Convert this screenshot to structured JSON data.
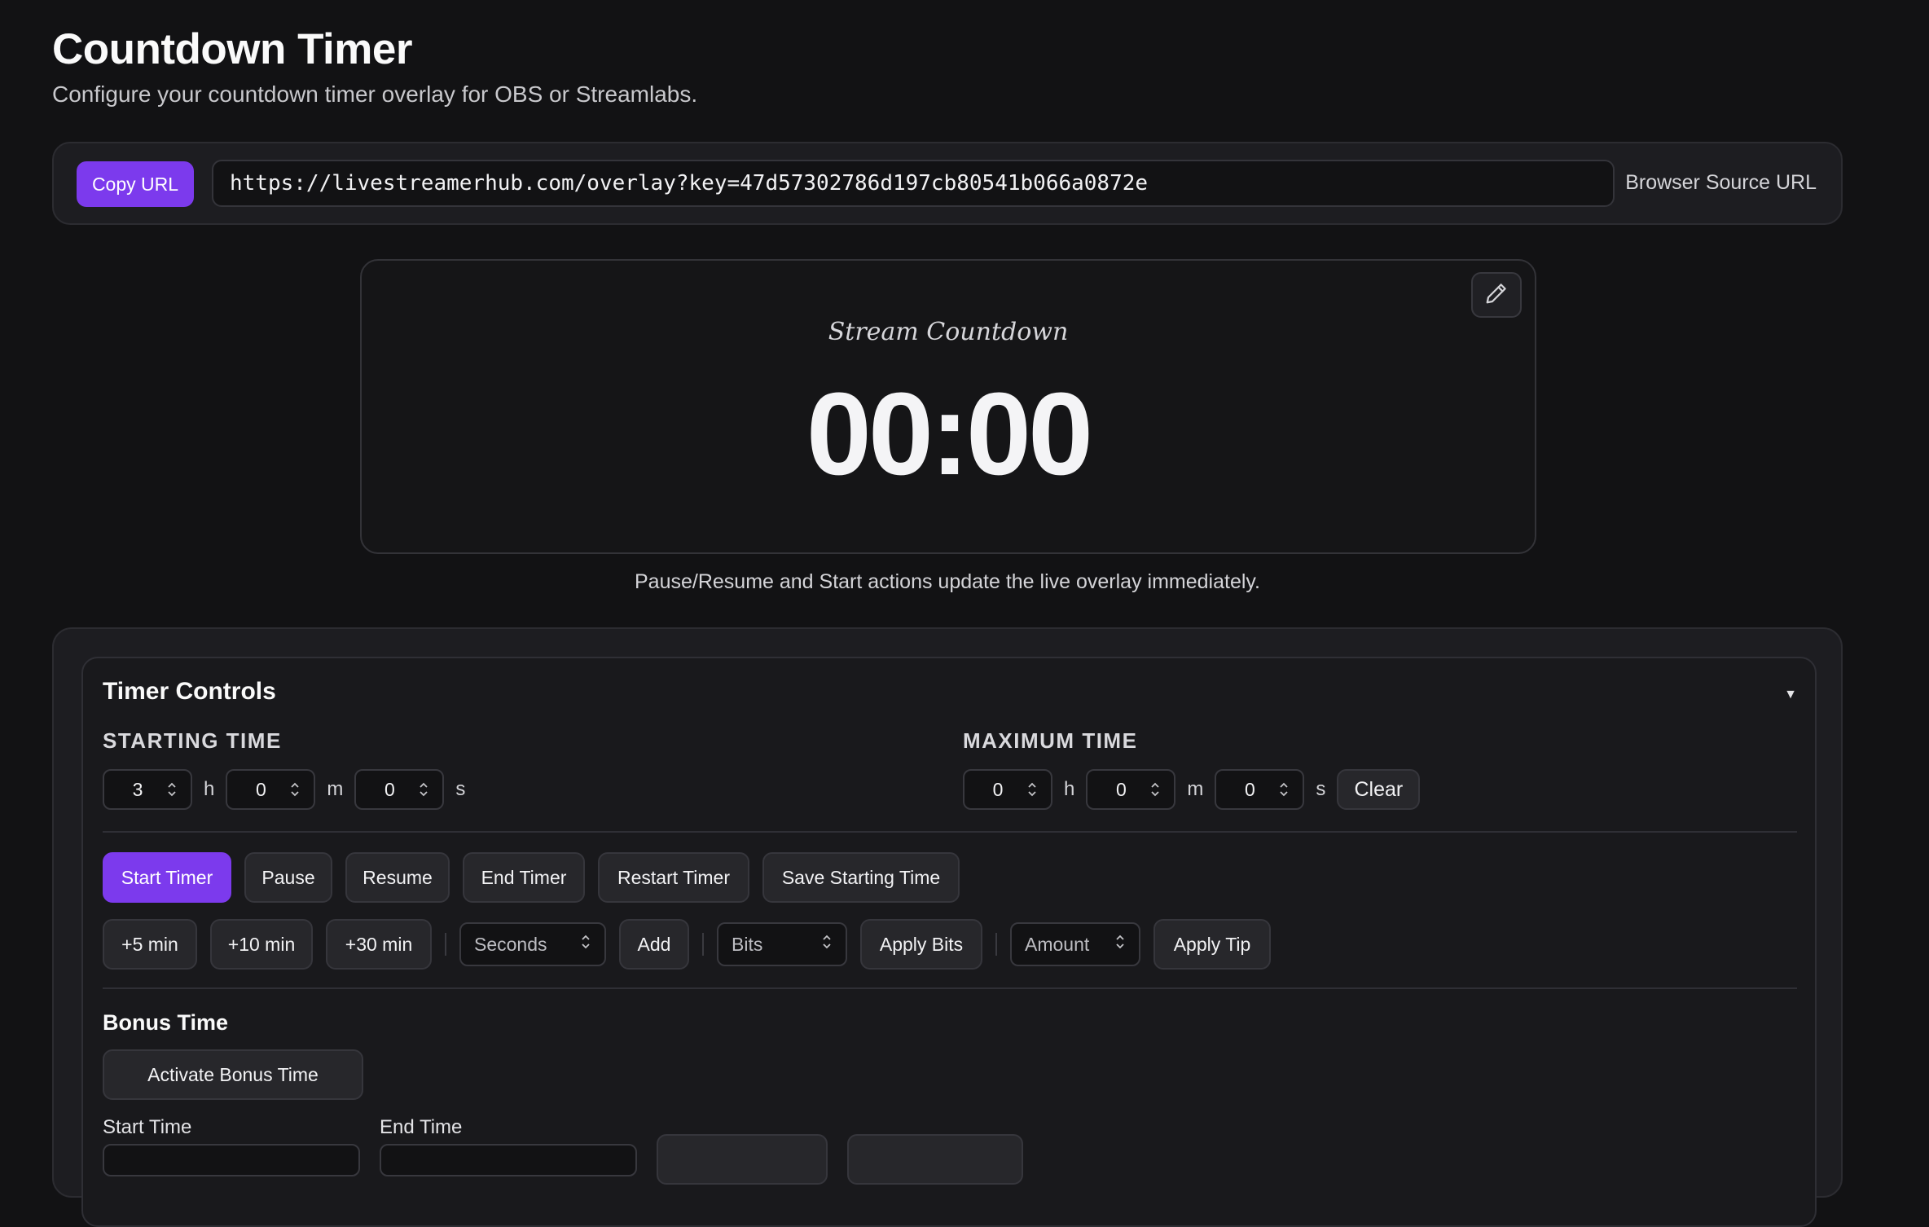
{
  "page": {
    "title": "Countdown Timer",
    "subtitle": "Configure your countdown timer overlay for OBS or Streamlabs."
  },
  "url_bar": {
    "copy_label": "Copy URL",
    "url": "https://livestreamerhub.com/overlay?key=47d57302786d197cb80541b066a0872e",
    "label": "Browser Source URL"
  },
  "preview": {
    "label": "Stream Countdown",
    "time": "00:00",
    "edit_icon": "pencil-icon",
    "note": "Pause/Resume and Start actions update the live overlay immediately."
  },
  "controls": {
    "title": "Timer Controls",
    "collapse_icon": "caret-down-icon",
    "starting_time": {
      "label": "STARTING TIME",
      "h": "3",
      "m": "0",
      "s": "0"
    },
    "maximum_time": {
      "label": "MAXIMUM TIME",
      "h": "0",
      "m": "0",
      "s": "0",
      "clear_label": "Clear"
    },
    "units": {
      "h": "h",
      "m": "m",
      "s": "s"
    },
    "actions": {
      "start": "Start Timer",
      "pause": "Pause",
      "resume": "Resume",
      "end": "End Timer",
      "restart": "Restart Timer",
      "save": "Save Starting Time"
    },
    "quick_add": {
      "plus5": "+5 min",
      "plus10": "+10 min",
      "plus30": "+30 min",
      "seconds_placeholder": "Seconds",
      "add_label": "Add",
      "bits_placeholder": "Bits",
      "apply_bits_label": "Apply Bits",
      "amount_placeholder": "Amount",
      "apply_tip_label": "Apply Tip"
    },
    "bonus": {
      "title": "Bonus Time",
      "activate_label": "Activate Bonus Time",
      "start_label": "Start Time",
      "end_label": "End Time"
    }
  },
  "colors": {
    "accent": "#7c3aed",
    "background": "#121214",
    "panel": "#1d1d21"
  }
}
